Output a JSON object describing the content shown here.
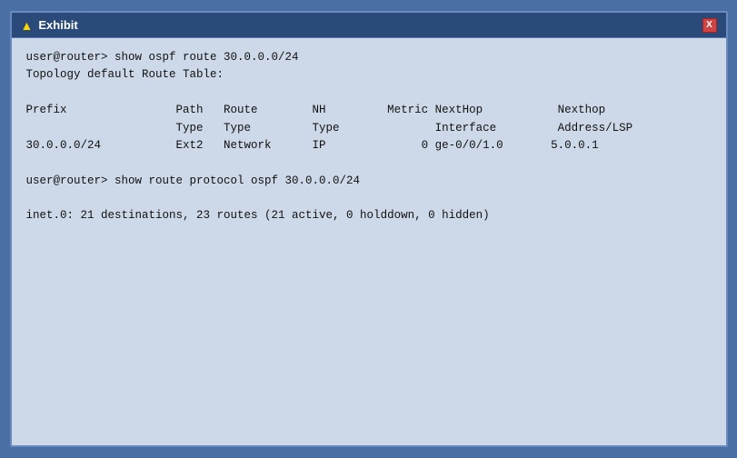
{
  "window": {
    "title": "Exhibit",
    "close_label": "X"
  },
  "terminal": {
    "lines": [
      "user@router> show ospf route 30.0.0.0/24",
      "Topology default Route Table:",
      "",
      "Prefix                Path   Route        NH         Metric NextHop           Nexthop",
      "                      Type   Type         Type              Interface         Address/LSP",
      "30.0.0.0/24           Ext2   Network      IP              0 ge-0/0/1.0       5.0.0.1",
      "",
      "user@router> show route protocol ospf 30.0.0.0/24",
      "",
      "inet.0: 21 destinations, 23 routes (21 active, 0 holddown, 0 hidden)"
    ]
  }
}
